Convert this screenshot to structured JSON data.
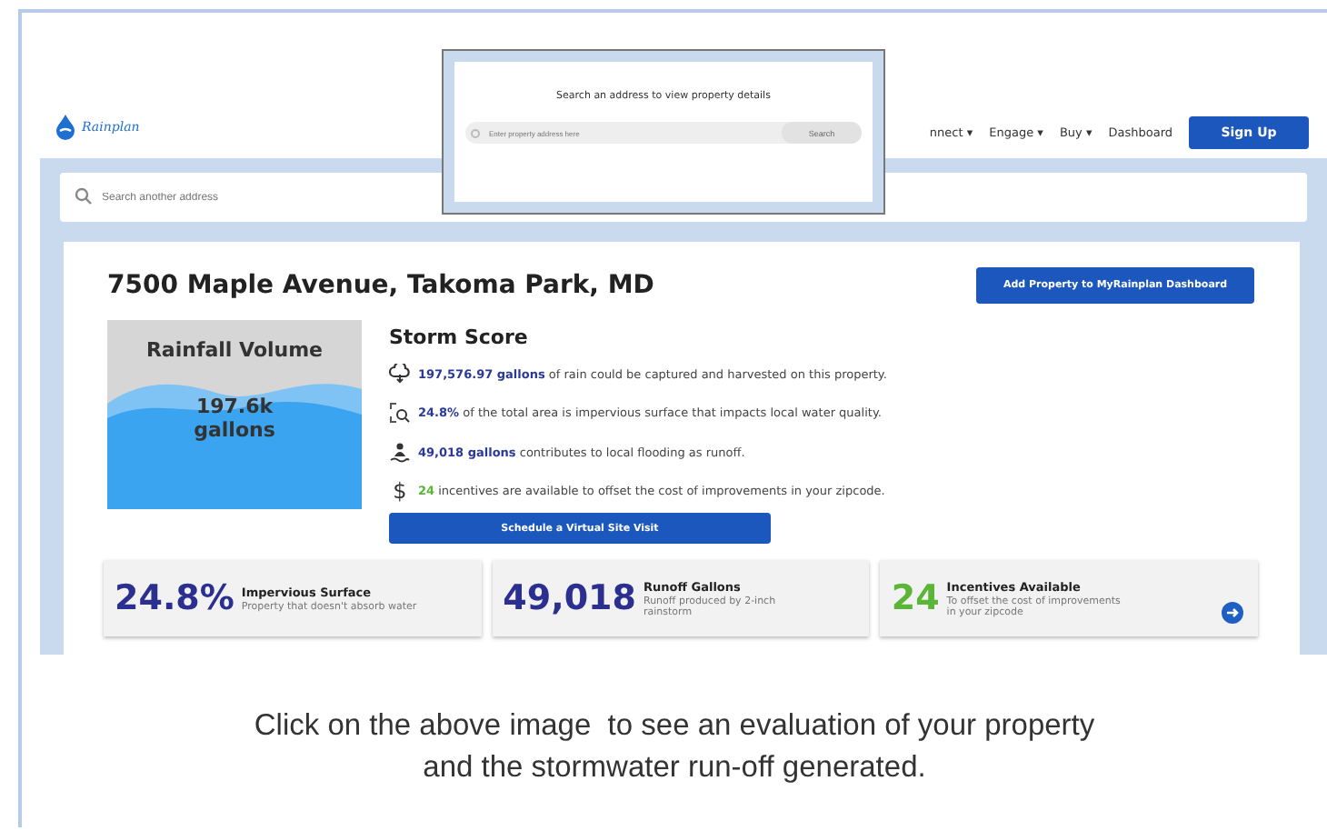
{
  "header": {
    "logo": "Rainplan",
    "nav": [
      {
        "label": "nnect",
        "caret": "▾"
      },
      {
        "label": "Engage",
        "caret": "▾"
      },
      {
        "label": "Buy",
        "caret": "▾"
      },
      {
        "label": "Dashboard"
      }
    ],
    "signup": "Sign Up"
  },
  "search": {
    "placeholder": "Search another address"
  },
  "popup": {
    "title": "Search an address to view property details",
    "placeholder": "Enter property address here",
    "button": "Search"
  },
  "property": {
    "address": "7500 Maple Avenue, Takoma Park, MD",
    "add_button": "Add Property to MyRainplan Dashboard",
    "rainfall": {
      "title": "Rainfall Volume",
      "value": "197.6k",
      "unit": "gallons"
    },
    "storm_score": {
      "title": "Storm Score",
      "facts": [
        {
          "kind": "cloud",
          "value": "197,576.97 gallons",
          "text": " of rain could be captured and harvested on this property.",
          "color": "#2b3a9a"
        },
        {
          "kind": "scan",
          "value": "24.8%",
          "text": " of the total area is impervious surface that impacts local water quality.",
          "color": "#2b3a9a"
        },
        {
          "kind": "flood",
          "value": "49,018 gallons",
          "text": " contributes to local flooding as runoff.",
          "color": "#2b3a9a"
        },
        {
          "kind": "dollar",
          "symbol": "$",
          "value": "24",
          "text": " incentives are available to offset the cost of improvements in your zipcode.",
          "color": "#5bb536"
        }
      ],
      "button": "Schedule a Virtual Site Visit"
    },
    "stats": [
      {
        "value": "24.8%",
        "title": "Impervious Surface",
        "description": "Property that doesn't absorb water",
        "color": "#2b2f8f",
        "arrow": false
      },
      {
        "value": "49,018",
        "title": "Runoff Gallons",
        "description": "Runoff produced by 2-inch rainstorm",
        "color": "#2b2f8f",
        "arrow": false
      },
      {
        "value": "24",
        "title": "Incentives Available",
        "description": "To offset the cost of improvements in your zipcode",
        "color": "#5bb536",
        "arrow": true
      }
    ]
  },
  "caption_lines": [
    "Click on the above image  to see an evaluation of your property",
    "and the stormwater run-off generated."
  ]
}
